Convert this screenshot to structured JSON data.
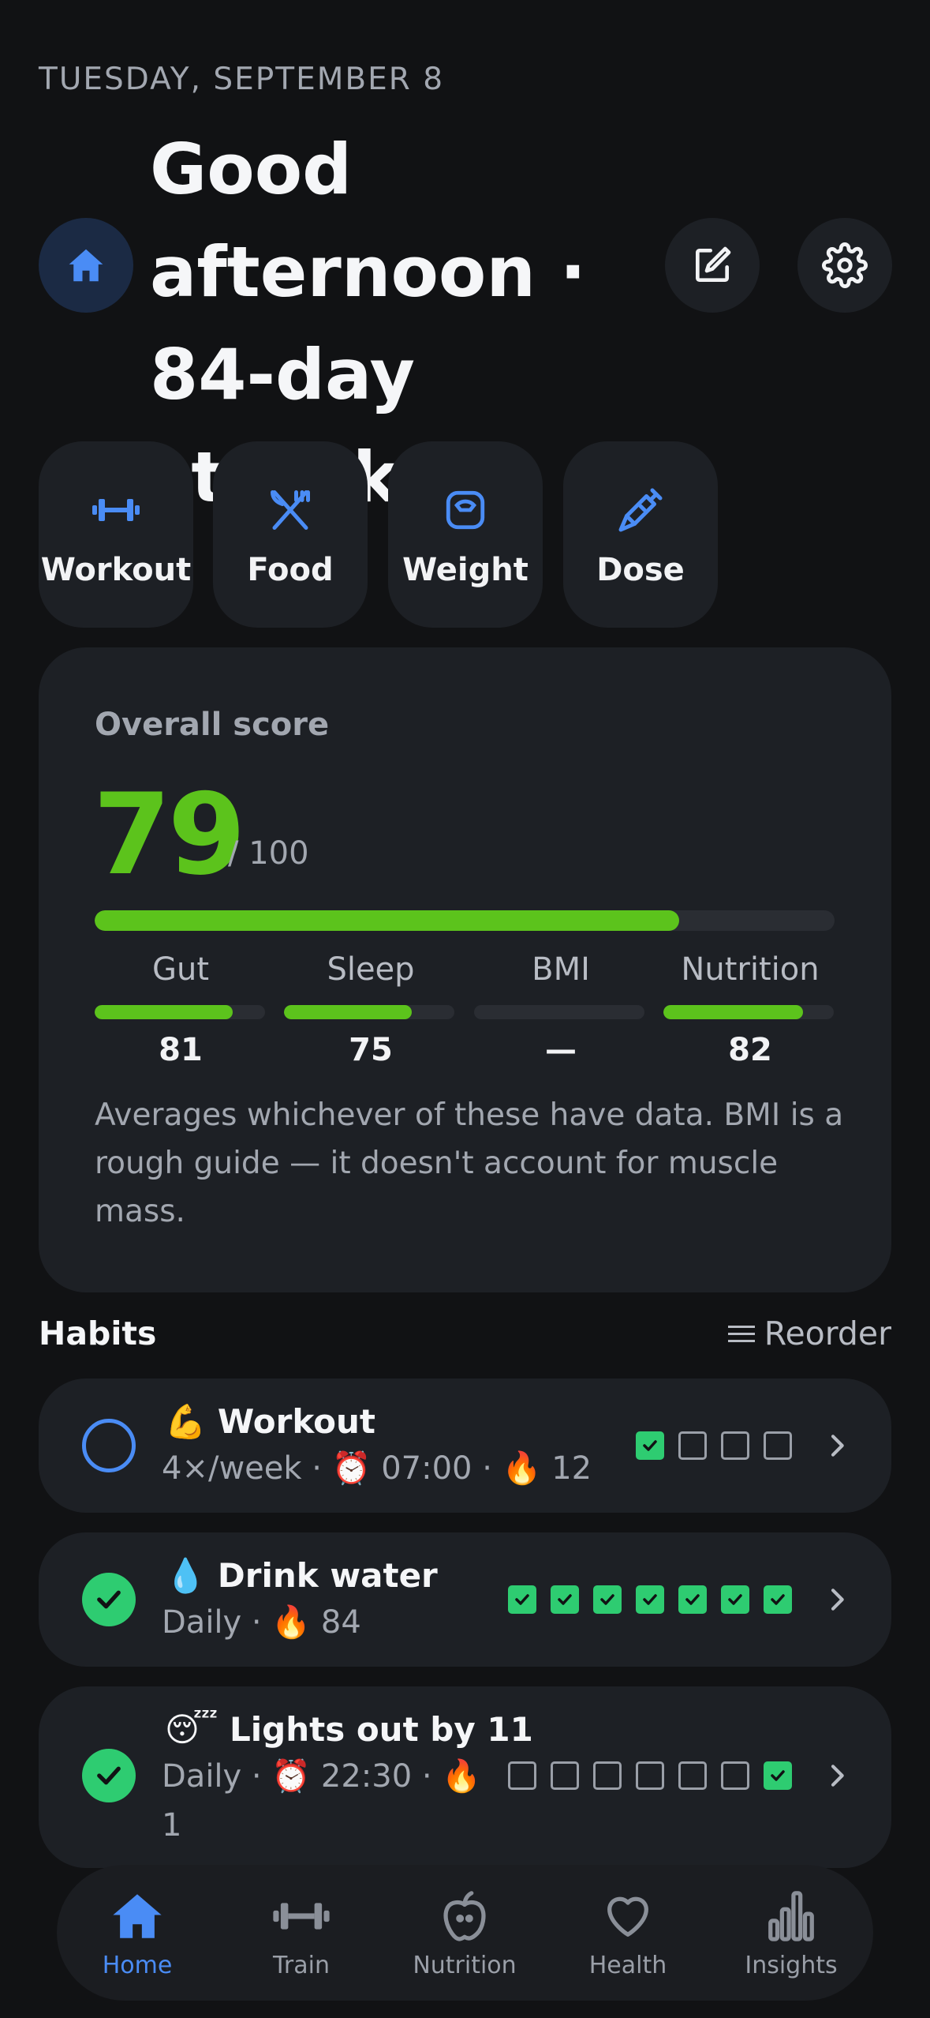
{
  "header": {
    "date": "TUESDAY, SEPTEMBER 8",
    "greeting": "Good afternoon · 84-day streak"
  },
  "quick_actions": [
    {
      "label": "Workout",
      "icon": "dumbbell-icon"
    },
    {
      "label": "Food",
      "icon": "fork-knife-icon"
    },
    {
      "label": "Weight",
      "icon": "scale-icon"
    },
    {
      "label": "Dose",
      "icon": "syringe-icon"
    }
  ],
  "score": {
    "title": "Overall score",
    "value": "79",
    "denominator": "/ 100",
    "progress": 0.79,
    "subscores": [
      {
        "label": "Gut",
        "value": "81",
        "progress": 0.81
      },
      {
        "label": "Sleep",
        "value": "75",
        "progress": 0.75
      },
      {
        "label": "BMI",
        "value": "—",
        "progress": 0
      },
      {
        "label": "Nutrition",
        "value": "82",
        "progress": 0.82
      }
    ],
    "note": "Averages whichever of these have data. BMI is a rough guide — it doesn't account for muscle mass."
  },
  "habits": {
    "title": "Habits",
    "reorder_label": "Reorder",
    "items": [
      {
        "emoji": "💪",
        "name": "Workout",
        "freq": "4×/week",
        "time": "07:00",
        "streak": "12",
        "done": false,
        "days": [
          true,
          false,
          false,
          false
        ]
      },
      {
        "emoji": "💧",
        "name": "Drink water",
        "freq": "Daily",
        "time": "",
        "streak": "84",
        "done": true,
        "days": [
          true,
          true,
          true,
          true,
          true,
          true,
          true
        ]
      },
      {
        "emoji": "😴",
        "name": "Lights out by 11",
        "freq": "Daily",
        "time": "22:30",
        "streak": "1",
        "done": true,
        "days": [
          false,
          false,
          false,
          false,
          false,
          false,
          true
        ]
      }
    ]
  },
  "meta_icons": {
    "alarm": "⏰",
    "fire": "🔥",
    "sep": " · "
  },
  "tabs": [
    {
      "label": "Home",
      "icon": "house-icon",
      "active": true
    },
    {
      "label": "Train",
      "icon": "dumbbell-icon",
      "active": false
    },
    {
      "label": "Nutrition",
      "icon": "apple-icon",
      "active": false
    },
    {
      "label": "Health",
      "icon": "heart-icon",
      "active": false
    },
    {
      "label": "Insights",
      "icon": "bar-chart-icon",
      "active": false
    }
  ],
  "colors": {
    "accent": "#4a8cf5",
    "score_green": "#5cc31c",
    "check_green": "#2ecc71",
    "background": "#111214",
    "card": "#1d2025"
  }
}
